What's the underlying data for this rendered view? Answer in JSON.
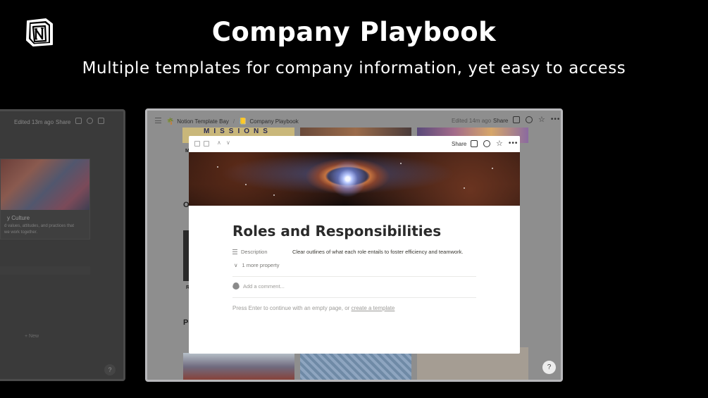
{
  "hero": {
    "title": "Company Playbook",
    "subtitle": "Multiple templates for company information, yet easy to access"
  },
  "left_window": {
    "edited": "Edited 13m ago",
    "share": "Share",
    "card_title": "y Culture",
    "card_desc_1": "d values, attitudes, and practices that",
    "card_desc_2": "we work together.",
    "new_label": "+ New",
    "help": "?"
  },
  "main_window": {
    "breadcrumbs": [
      {
        "icon": "🌴",
        "label": "Notion Template Bay"
      },
      {
        "icon": "📒",
        "label": "Company Playbook"
      }
    ],
    "separator": "/",
    "edited": "Edited 14m ago",
    "share": "Share",
    "background": {
      "missions_text": "MISSIONS",
      "section_o": "O",
      "section_p": "Po",
      "row_letter_m": "M",
      "row_letter_r": "R"
    },
    "help": "?"
  },
  "modal": {
    "share": "Share",
    "title": "Roles and Responsibilities",
    "property_name": "Description",
    "property_value": "Clear outlines of what each role entails to foster efficiency and teamwork.",
    "more_property": "1 more property",
    "comment_placeholder": "Add a comment...",
    "empty_hint_prefix": "Press Enter to continue with an empty page, or",
    "empty_hint_link": "create a template"
  }
}
